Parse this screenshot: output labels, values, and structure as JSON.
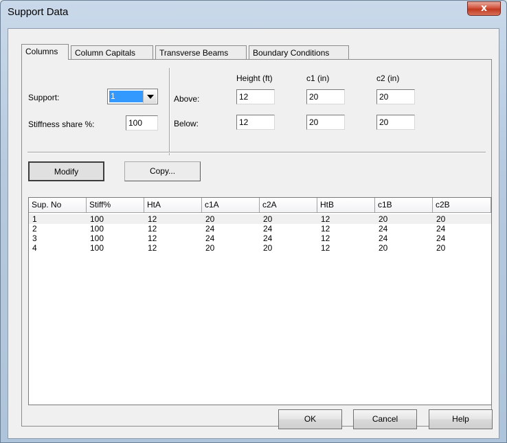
{
  "window": {
    "title": "Support Data",
    "close_glyph": "x"
  },
  "tabs": [
    "Columns",
    "Column Capitals",
    "Transverse Beams",
    "Boundary Conditions"
  ],
  "form": {
    "support_label": "Support:",
    "support_value": "1",
    "stiffness_label": "Stiffness share %:",
    "stiffness_value": "100",
    "col_height": "Height (ft)",
    "col_c1": "c1 (in)",
    "col_c2": "c2 (in)",
    "above_label": "Above:",
    "below_label": "Below:",
    "above": {
      "height": "12",
      "c1": "20",
      "c2": "20"
    },
    "below": {
      "height": "12",
      "c1": "20",
      "c2": "20"
    }
  },
  "buttons": {
    "modify": "Modify",
    "copy": "Copy...",
    "ok": "OK",
    "cancel": "Cancel",
    "help": "Help"
  },
  "table": {
    "columns": [
      "Sup. No",
      "Stiff%",
      "HtA",
      "c1A",
      "c2A",
      "HtB",
      "c1B",
      "c2B"
    ],
    "rows": [
      [
        "1",
        "100",
        "12",
        "20",
        "20",
        "12",
        "20",
        "20"
      ],
      [
        "2",
        "100",
        "12",
        "24",
        "24",
        "12",
        "24",
        "24"
      ],
      [
        "3",
        "100",
        "12",
        "24",
        "24",
        "12",
        "24",
        "24"
      ],
      [
        "4",
        "100",
        "12",
        "20",
        "20",
        "12",
        "20",
        "20"
      ]
    ]
  },
  "icons": {
    "close": "close-icon",
    "dropdown": "chevron-down-icon"
  }
}
